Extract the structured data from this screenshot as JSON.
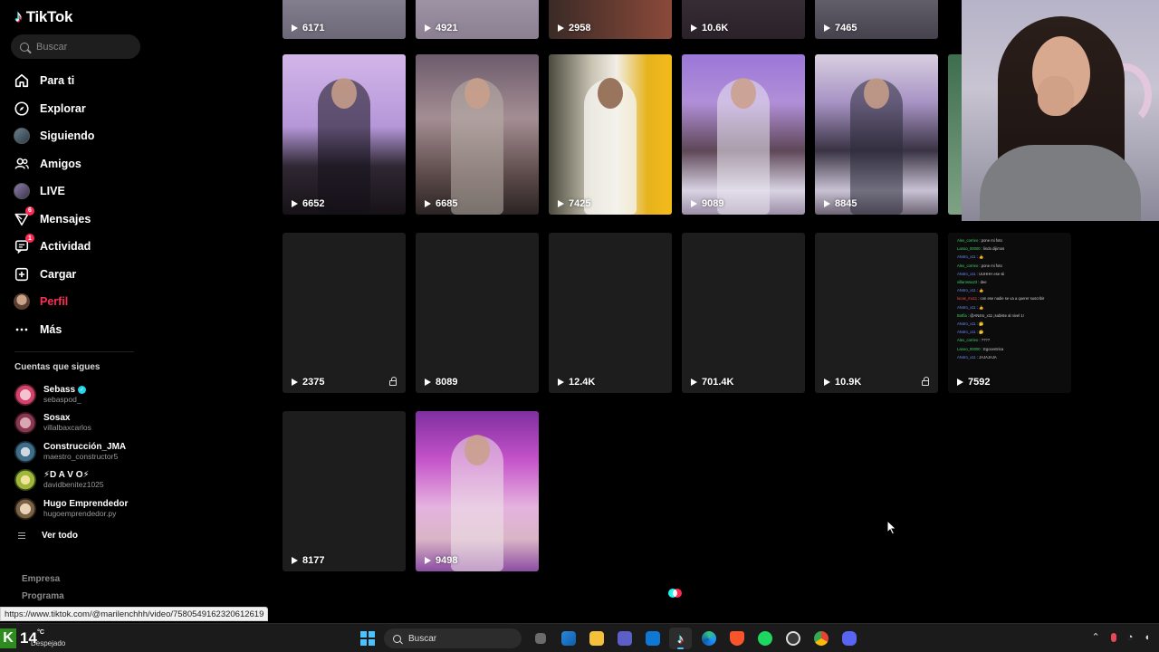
{
  "app": {
    "brand": "TikTok"
  },
  "search": {
    "placeholder": "Buscar"
  },
  "nav": [
    {
      "label": "Para ti",
      "icon": "home-icon"
    },
    {
      "label": "Explorar",
      "icon": "compass-icon"
    },
    {
      "label": "Siguiendo",
      "icon": "following-avatar-icon"
    },
    {
      "label": "Amigos",
      "icon": "friends-icon"
    },
    {
      "label": "LIVE",
      "icon": "live-avatar-icon"
    },
    {
      "label": "Mensajes",
      "icon": "messages-icon",
      "badge": "6"
    },
    {
      "label": "Actividad",
      "icon": "activity-icon",
      "badge": "1"
    },
    {
      "label": "Cargar",
      "icon": "upload-icon"
    },
    {
      "label": "Perfil",
      "icon": "profile-avatar-icon",
      "active": true
    },
    {
      "label": "Más",
      "icon": "more-icon"
    }
  ],
  "following": {
    "title": "Cuentas que sigues",
    "accounts": [
      {
        "name": "Sebass",
        "handle": "sebaspod_",
        "verified": true
      },
      {
        "name": "Sosax",
        "handle": "villalbaxcarlos"
      },
      {
        "name": "Construcción_JMA",
        "handle": "maestro_constructor5"
      },
      {
        "name": "⚡D A V O⚡",
        "handle": "davidbenitez1025"
      },
      {
        "name": "Hugo Emprendedor",
        "handle": "hugoemprendedor.py"
      }
    ],
    "see_all": "Ver todo"
  },
  "footer": {
    "links": [
      "Empresa",
      "Programa"
    ]
  },
  "videos": [
    {
      "views": "6171"
    },
    {
      "views": "4921"
    },
    {
      "views": "2958"
    },
    {
      "views": "10.6K"
    },
    {
      "views": "7465"
    },
    {
      "views": "6652"
    },
    {
      "views": "6685"
    },
    {
      "views": "7425"
    },
    {
      "views": "9089"
    },
    {
      "views": "8845"
    },
    {
      "views": "2375",
      "locked": true
    },
    {
      "views": "8089"
    },
    {
      "views": "12.4K"
    },
    {
      "views": "701.4K"
    },
    {
      "views": "10.9K",
      "locked": true
    },
    {
      "views": "7592"
    },
    {
      "views": "8177"
    },
    {
      "views": "9498"
    }
  ],
  "chat": [
    {
      "user": "Alex_corrieo",
      "msg": ": pone mi foto"
    },
    {
      "user": "Lanoo_00000",
      "msg": ": lindo dijimos"
    },
    {
      "user": "AN4ro_x11",
      "msg": ": 👍"
    },
    {
      "user": "Alex_corrieo",
      "msg": ": pone mi foto"
    },
    {
      "user": "AN4ro_x11",
      "msg": ": UUHHH ese sii"
    },
    {
      "user": "villarossa23",
      "msg": ": dee"
    },
    {
      "user": "AN4ro_x11",
      "msg": ": 👍"
    },
    {
      "user": "lucas_mx11",
      "msg": ": con ese nadie se va a querer suscribir"
    },
    {
      "user": "AN4ro_x11",
      "msg": ": 👍"
    },
    {
      "user": "Botfia",
      "msg": ": @AN4ro_x11 ¡subiste al nivel 1!"
    },
    {
      "user": "AN4ro_x11",
      "msg": ": 🤔"
    },
    {
      "user": "AN4ro_x11",
      "msg": ": 🤔"
    },
    {
      "user": "Alex_corrieo",
      "msg": ": ????"
    },
    {
      "user": "Lanoo_00000",
      "msg": ": Egocentrica"
    },
    {
      "user": "AN4ro_x11",
      "msg": ": JAJAJAJA"
    }
  ],
  "status_url": "https://www.tiktok.com/@marilenchhh/video/7580549162320612619",
  "taskbar": {
    "temp": "14",
    "unit": "°C",
    "condition": "Despejado",
    "search_label": "Buscar",
    "apps": [
      "task-view-icon",
      "store-icon",
      "file-explorer-icon",
      "teams-icon",
      "outlook-icon",
      "tiktok-icon",
      "edge-icon",
      "brave-icon",
      "spotify-icon",
      "obs-icon",
      "chrome-icon",
      "discord-icon"
    ],
    "colors": {
      "accent": "#4cc2ff"
    }
  },
  "colors": {
    "brand_red": "#fe2c55",
    "brand_cyan": "#25f4ee"
  }
}
